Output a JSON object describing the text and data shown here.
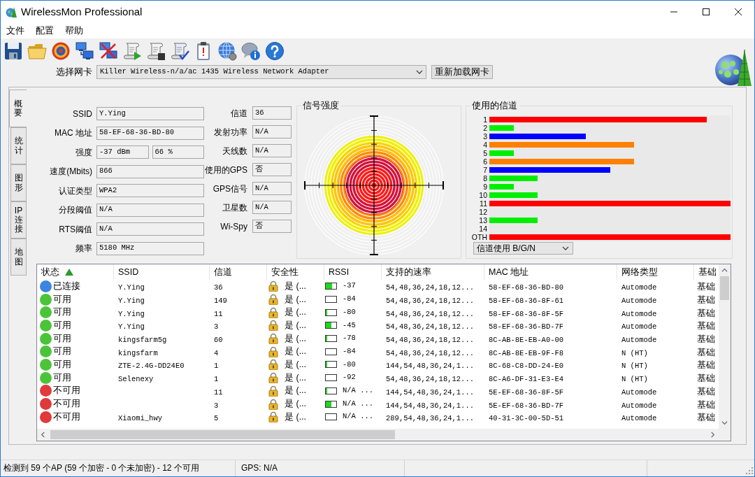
{
  "window": {
    "title": "WirelessMon Professional"
  },
  "menu": [
    "文件",
    "配置",
    "帮助"
  ],
  "adapter": {
    "label": "选择网卡",
    "value": "Killer Wireless-n/a/ac 1435 Wireless Network Adapter",
    "reload_button": "重新加载网卡"
  },
  "tabs": [
    {
      "label": "概要",
      "selected": true
    },
    {
      "label": "统计",
      "selected": false
    },
    {
      "label": "图形",
      "selected": false
    },
    {
      "label": "IP 连接",
      "selected": false
    },
    {
      "label": "地图",
      "selected": false
    }
  ],
  "summary": {
    "left_fields": [
      {
        "label": "SSID",
        "values": [
          "Y.Ying"
        ]
      },
      {
        "label": "MAC 地址",
        "values": [
          "58-EF-68-36-BD-80"
        ]
      },
      {
        "label": "强度",
        "values": [
          "-37 dBm",
          "66 %"
        ]
      },
      {
        "label": "速度(Mbits)",
        "values": [
          "866"
        ]
      },
      {
        "label": "认证类型",
        "values": [
          "WPA2"
        ]
      },
      {
        "label": "分段阈值",
        "values": [
          "N/A"
        ]
      },
      {
        "label": "RTS阈值",
        "values": [
          "N/A"
        ]
      },
      {
        "label": "频率",
        "values": [
          "5180 MHz"
        ]
      }
    ],
    "right_fields": [
      {
        "label": "信道",
        "value": "36"
      },
      {
        "label": "发射功率",
        "value": "N/A"
      },
      {
        "label": "天线数",
        "value": "N/A"
      },
      {
        "label": "使用的GPS",
        "value": "否"
      },
      {
        "label": "GPS信号",
        "value": "N/A"
      },
      {
        "label": "卫星数",
        "value": "N/A"
      },
      {
        "label": "Wi-Spy",
        "value": "否"
      }
    ]
  },
  "signal_strength": {
    "title": "信号强度"
  },
  "channel_usage": {
    "title": "使用的信道",
    "channels": [
      {
        "label": "1",
        "level": 0.9,
        "color": "#ff0000"
      },
      {
        "label": "2",
        "level": 0.1,
        "color": "#00ee00"
      },
      {
        "label": "3",
        "level": 0.4,
        "color": "#0000ff"
      },
      {
        "label": "4",
        "level": 0.6,
        "color": "#ff8000"
      },
      {
        "label": "5",
        "level": 0.1,
        "color": "#00ee00"
      },
      {
        "label": "6",
        "level": 0.6,
        "color": "#ff8000"
      },
      {
        "label": "7",
        "level": 0.5,
        "color": "#0000ff"
      },
      {
        "label": "8",
        "level": 0.2,
        "color": "#00ee00"
      },
      {
        "label": "9",
        "level": 0.1,
        "color": "#00ee00"
      },
      {
        "label": "10",
        "level": 0.2,
        "color": "#00ee00"
      },
      {
        "label": "11",
        "level": 1,
        "color": "#ff0000"
      },
      {
        "label": "12"
      },
      {
        "label": "13",
        "level": 0.2,
        "color": "#00ee00"
      },
      {
        "label": "14"
      },
      {
        "label": "OTH",
        "level": 1,
        "color": "#ff0000"
      }
    ],
    "filter": "信道使用 B/G/N"
  },
  "network_table": {
    "columns": [
      {
        "label": "状态",
        "sorted": true
      },
      {
        "label": "SSID",
        "sorted": false
      },
      {
        "label": "信道",
        "sorted": false
      },
      {
        "label": "安全性",
        "sorted": false
      },
      {
        "label": "RSSI",
        "sorted": false
      },
      {
        "label": "支持的速率",
        "sorted": false
      },
      {
        "label": "MAC 地址",
        "sorted": false
      },
      {
        "label": "网络类型",
        "sorted": false
      },
      {
        "label": "基础",
        "sorted": false
      }
    ],
    "rows": [
      {
        "color": "#3a86e0",
        "status": "已连接",
        "ssid": "Y.Ying",
        "channel": "36",
        "security": "是 (...",
        "level": 0.6,
        "rssi": "-37",
        "rates": "54,48,36,24,18,12...",
        "mac": "58-EF-68-36-BD-80",
        "network_type": "Automode",
        "column_9": "基础"
      },
      {
        "color": "#4cc43a",
        "status": "可用",
        "ssid": "Y.Ying",
        "channel": "149",
        "security": "是 (...",
        "rssi": "-84",
        "rates": "54,48,36,24,18,12...",
        "mac": "58-EF-68-36-8F-61",
        "network_type": "Automode",
        "column_9": "基础"
      },
      {
        "color": "#4cc43a",
        "status": "可用",
        "ssid": "Y.Ying",
        "channel": "11",
        "security": "是 (...",
        "level": 0.14,
        "rssi": "-80",
        "rates": "54,48,36,24,18,12...",
        "mac": "58-EF-68-36-8F-5F",
        "network_type": "Automode",
        "column_9": "基础"
      },
      {
        "color": "#4cc43a",
        "status": "可用",
        "ssid": "Y.Ying",
        "channel": "3",
        "security": "是 (...",
        "level": 0.5,
        "rssi": "-45",
        "rates": "54,48,36,24,18,12...",
        "mac": "58-EF-68-36-BD-7F",
        "network_type": "Automode",
        "column_9": "基础"
      },
      {
        "color": "#4cc43a",
        "status": "可用",
        "ssid": "kingsfarm5g",
        "channel": "60",
        "security": "是 (...",
        "level": 0.14,
        "rssi": "-78",
        "rates": "54,48,36,24,18,12...",
        "mac": "8C-AB-8E-EB-A0-00",
        "network_type": "Automode",
        "column_9": "基础"
      },
      {
        "color": "#4cc43a",
        "status": "可用",
        "ssid": "kingsfarm",
        "channel": "4",
        "security": "是 (...",
        "rssi": "-84",
        "rates": "54,48,36,24,18,12...",
        "mac": "8C-AB-8E-EB-9F-F8",
        "network_type": "N (HT)",
        "column_9": "基础"
      },
      {
        "color": "#4cc43a",
        "status": "可用",
        "ssid": "ZTE-2.4G-DD24E0",
        "channel": "1",
        "security": "是 (...",
        "level": 0.14,
        "rssi": "-80",
        "rates": "144,54,48,36,24,1...",
        "mac": "8C-68-C8-DD-24-E0",
        "network_type": "N (HT)",
        "column_9": "基础"
      },
      {
        "color": "#4cc43a",
        "status": "可用",
        "ssid": "Selenexy",
        "channel": "1",
        "security": "是 (...",
        "rssi": "-92",
        "rates": "54,48,36,24,18,12...",
        "mac": "8C-A6-DF-31-E3-E4",
        "network_type": "N (HT)",
        "column_9": "基础"
      },
      {
        "color": "#e03a3a",
        "status": "不可用",
        "channel": "11",
        "security": "是 (...",
        "level": 0.14,
        "rssi": "N/A ...",
        "rates": "144,54,48,36,24,1...",
        "mac": "5E-EF-68-36-8F-5F",
        "network_type": "Automode",
        "column_9": "基础"
      },
      {
        "color": "#e03a3a",
        "status": "不可用",
        "channel": "3",
        "security": "是 (...",
        "level": 0.5,
        "rssi": "N/A ...",
        "rates": "144,54,48,36,24,1...",
        "mac": "5E-EF-68-36-BD-7F",
        "network_type": "Automode",
        "column_9": "基础"
      },
      {
        "color": "#e03a3a",
        "status": "不可用",
        "ssid": "Xiaomi_hwy",
        "channel": "5",
        "security": "是 (...",
        "rssi": "N/A ...",
        "rates": "289,54,48,36,24,1...",
        "mac": "40-31-3C-00-5D-51",
        "network_type": "Automode",
        "column_9": "基础"
      }
    ]
  },
  "status_bar": [
    "检测到 59 个AP (59 个加密 - 0 个未加密) - 12 个可用",
    "GPS: N/A"
  ]
}
